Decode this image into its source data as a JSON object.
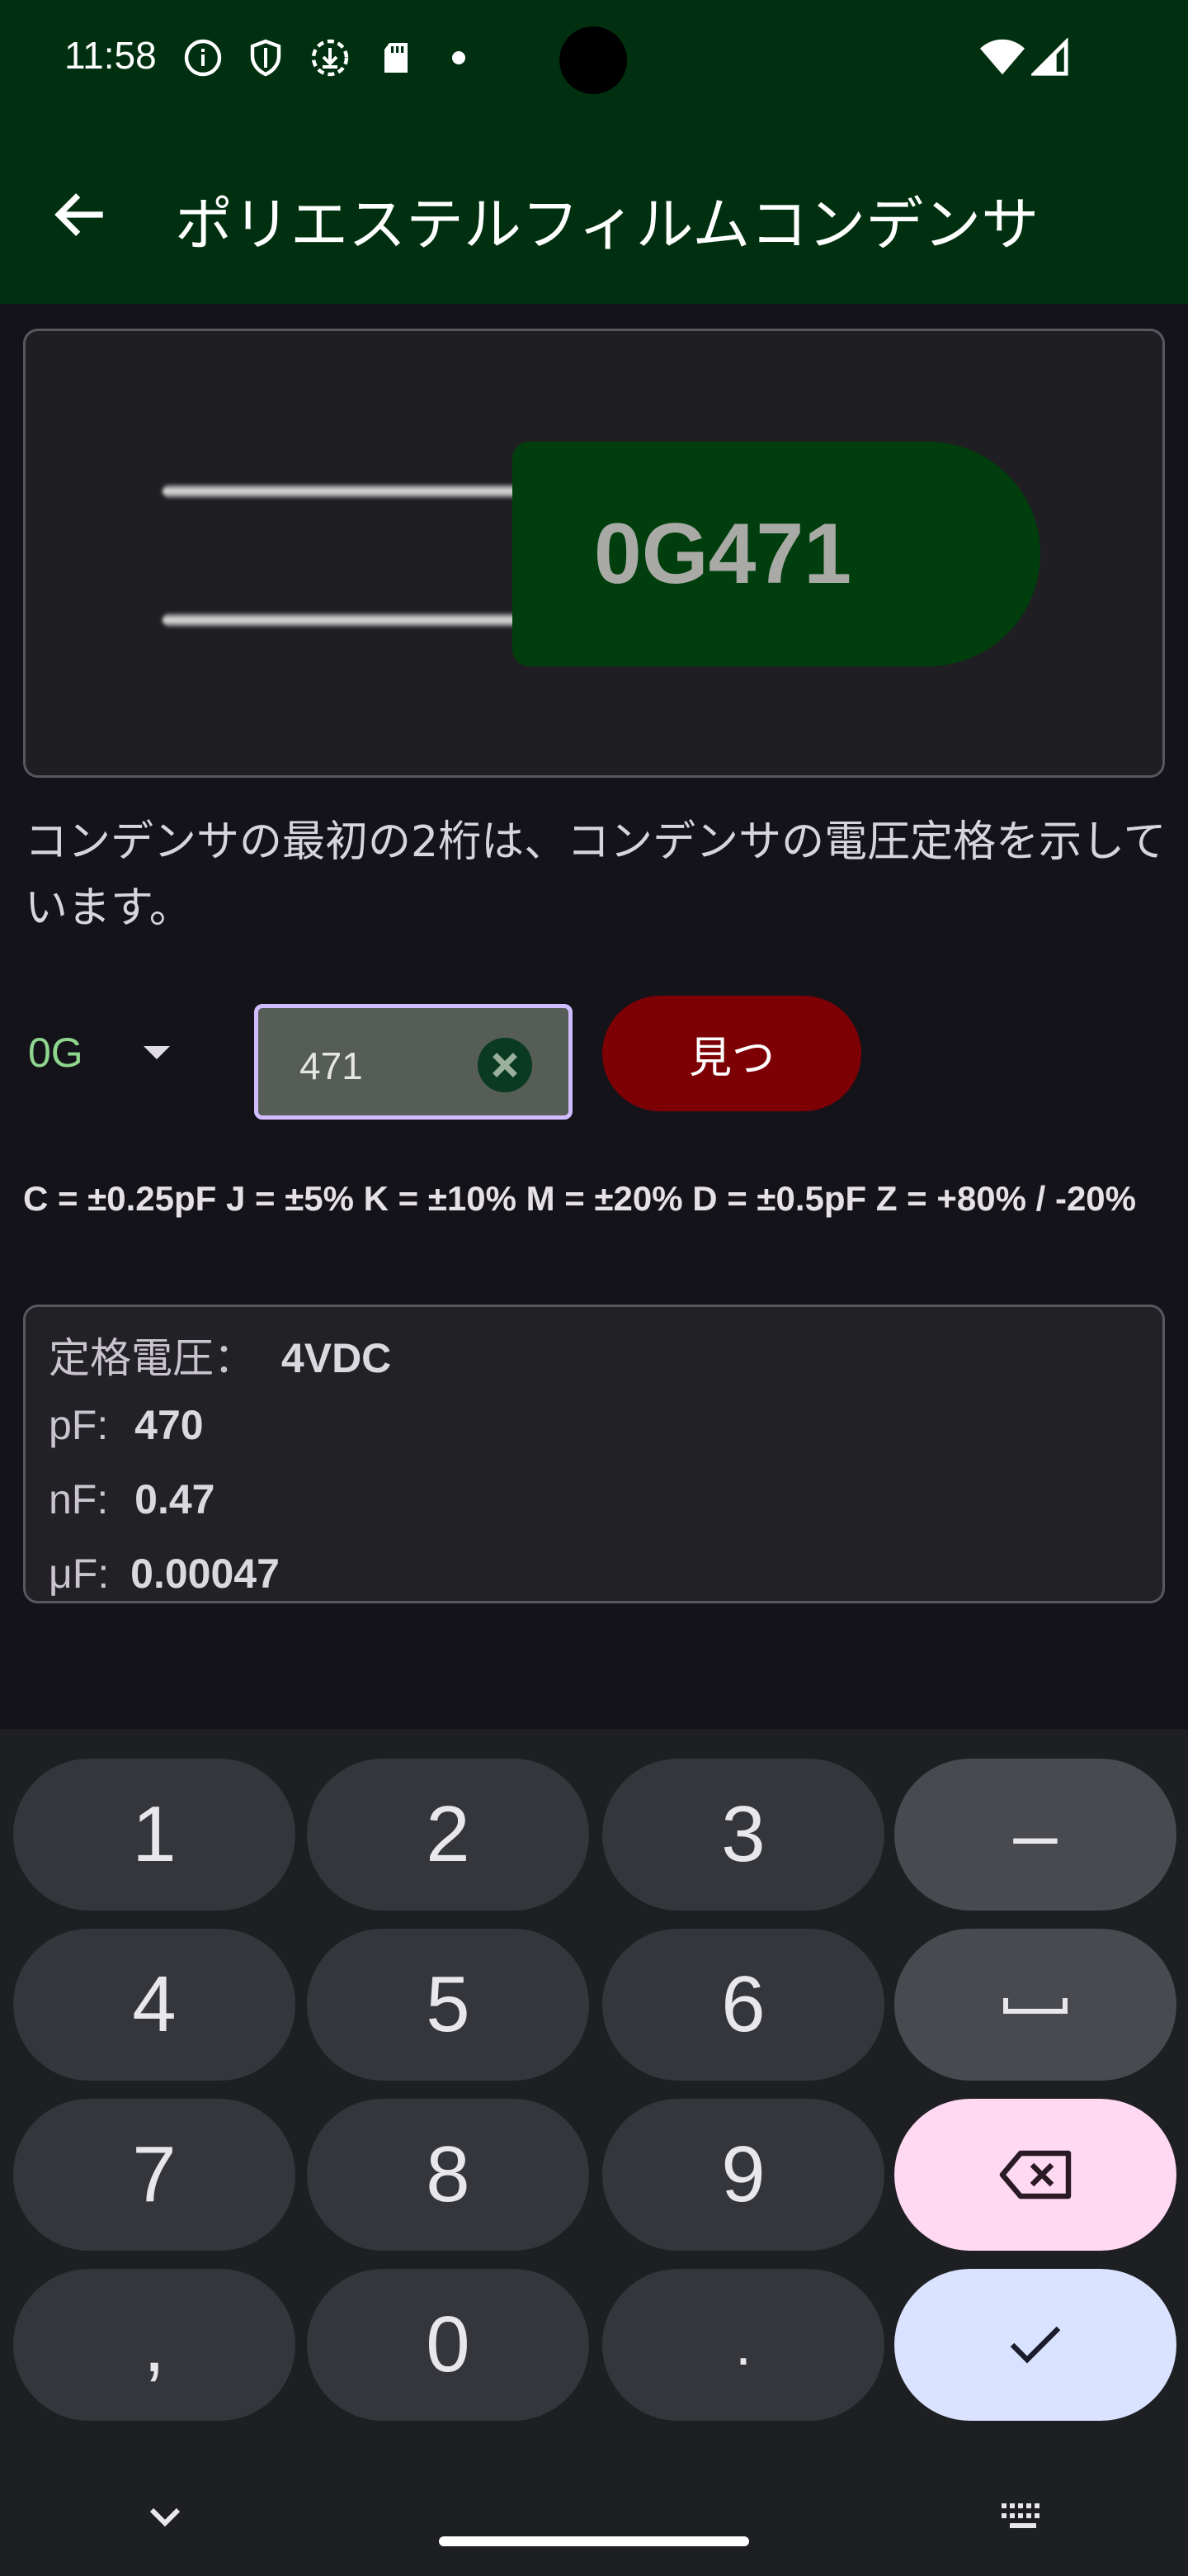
{
  "status_bar": {
    "time": "11:58",
    "icons": [
      "info-icon",
      "shield-icon",
      "download-icon",
      "sd-card-icon",
      "dot-icon",
      "wifi-icon",
      "signal-icon"
    ]
  },
  "app_bar": {
    "title": "ポリエステルフィルムコンデンサ"
  },
  "capacitor": {
    "code_label": "0G471",
    "body_color": "#003f0d"
  },
  "description": "コンデンサの最初の2桁は、コンデンサの電圧定格を示しています。",
  "controls": {
    "voltage_code": "0G",
    "code_value": "471",
    "find_label": "見つ"
  },
  "tolerance_text": "C = ±0.25pF J = ±5% K = ±10% M = ±20% D = ±0.5pF Z = +80% / -20%",
  "results": {
    "voltage_label": "定格電圧：",
    "voltage_value": "4VDC",
    "pf_label": "pF:",
    "pf_value": "470",
    "nf_label": "nF:",
    "nf_value": "0.47",
    "uf_label": "μF:",
    "uf_value": "0.00047"
  },
  "keyboard": {
    "keys": [
      "1",
      "2",
      "3",
      "–",
      "4",
      "5",
      "6",
      "space",
      "7",
      "8",
      "9",
      "backspace",
      ",",
      "0",
      ".",
      "done"
    ],
    "k1": "1",
    "k2": "2",
    "k3": "3",
    "kminus": "–",
    "k4": "4",
    "k5": "5",
    "k6": "6",
    "k7": "7",
    "k8": "8",
    "k9": "9",
    "kcomma": ",",
    "k0": "0",
    "kdot": "."
  },
  "colors": {
    "app_bar": "#00300f",
    "find_button": "#7d0005",
    "input_border": "#d1bcff",
    "voltage_code": "#8fd78f"
  }
}
